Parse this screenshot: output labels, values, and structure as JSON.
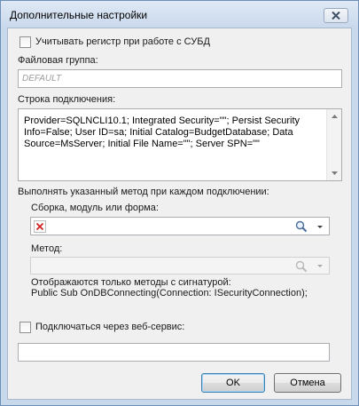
{
  "window": {
    "title": "Дополнительные настройки"
  },
  "options": {
    "case_sensitive_label": "Учитывать регистр при работе с СУБД",
    "case_sensitive_checked": false,
    "web_service_label": "Подключаться через веб-сервис:",
    "web_service_checked": false
  },
  "file_group": {
    "label": "Файловая группа:",
    "placeholder": "DEFAULT"
  },
  "connection": {
    "label": "Строка подключения:",
    "value": "Provider=SQLNCLI10.1; Integrated Security=\"\"; Persist Security Info=False; User ID=sa; Initial Catalog=BudgetDatabase; Data Source=MsServer; Initial File Name=\"\"; Server SPN=\"\""
  },
  "method_section": {
    "label": "Выполнять указанный метод при каждом подключении:",
    "assembly_label": "Сборка, модуль или форма:",
    "method_label": "Метод:",
    "hint_line1": "Отображаются только методы с сигнатурой:",
    "hint_line2": "Public Sub OnDBConnecting(Connection: ISecurityConnection);"
  },
  "buttons": {
    "ok": "OK",
    "cancel": "Отмена"
  },
  "icons": {
    "close": "close-icon",
    "clear": "red-x-icon",
    "search": "magnifier-icon",
    "dropdown": "chevron-down-icon"
  }
}
